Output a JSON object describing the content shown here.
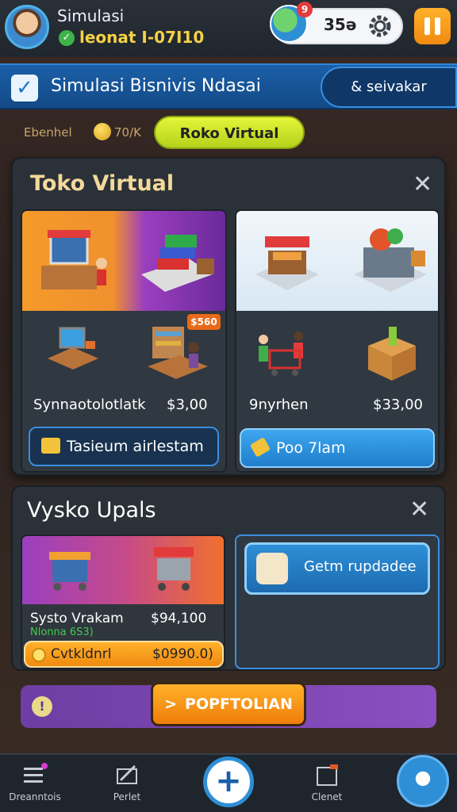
{
  "header": {
    "player_name": "Simulasi",
    "player_status": "leonat I-07I10",
    "notification_count": "9",
    "coins": "35ə"
  },
  "banner": {
    "title": "Simulasi Bisnivis Ndasai",
    "action": "& seivakar"
  },
  "hud": {
    "stat1": "Ebenhel",
    "stat2": "70/K",
    "shop_button": "Roko Virtual"
  },
  "shop_panel": {
    "title": "Toko Virtual",
    "cards": [
      {
        "name": "Synnaotolotlatk",
        "price": "$3,00",
        "badge": "$560",
        "button": "Tasieum airlestam"
      },
      {
        "name": "9nyrhen",
        "price": "$33,00",
        "button": "Poo 7lam"
      }
    ]
  },
  "upgrade_panel": {
    "title": "Vysko Upals",
    "card": {
      "name": "Systo Vrakam",
      "sub": "Nlonna 6S3)",
      "price": "$94,100",
      "button_label": "Cvtkldnrl",
      "button_price": "$0990.0)"
    },
    "side_button": "Getm rupdadee"
  },
  "bar": {
    "info": "!",
    "portfolio_button": "POPFTOLIAN"
  },
  "nav": {
    "item1": "Dreanntois",
    "item2": "Perlet",
    "item4": "Clenet"
  },
  "colors": {
    "accent_blue": "#2f8fd6",
    "accent_orange": "#f08a10",
    "accent_yellow": "#e5f53a",
    "panel_bg": "#2b3138"
  }
}
